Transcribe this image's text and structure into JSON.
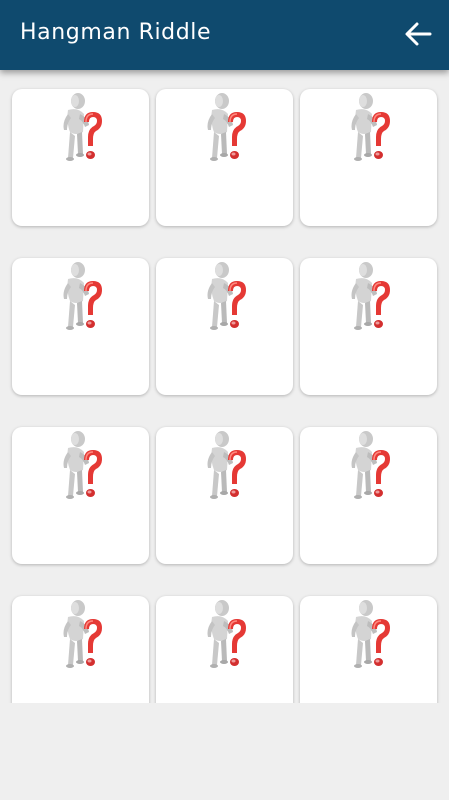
{
  "appbar": {
    "title": "Hangman Riddle",
    "back_icon": "arrow-left-icon",
    "background": "#0f4a6e"
  },
  "levels": [
    {
      "icon": "question-figure-icon",
      "locked": true
    },
    {
      "icon": "question-figure-icon",
      "locked": true
    },
    {
      "icon": "question-figure-icon",
      "locked": true
    },
    {
      "icon": "question-figure-icon",
      "locked": true
    },
    {
      "icon": "question-figure-icon",
      "locked": true
    },
    {
      "icon": "question-figure-icon",
      "locked": true
    },
    {
      "icon": "question-figure-icon",
      "locked": true
    },
    {
      "icon": "question-figure-icon",
      "locked": true
    },
    {
      "icon": "question-figure-icon",
      "locked": true
    },
    {
      "icon": "question-figure-icon",
      "locked": true
    },
    {
      "icon": "question-figure-icon",
      "locked": true
    },
    {
      "icon": "question-figure-icon",
      "locked": true
    }
  ]
}
